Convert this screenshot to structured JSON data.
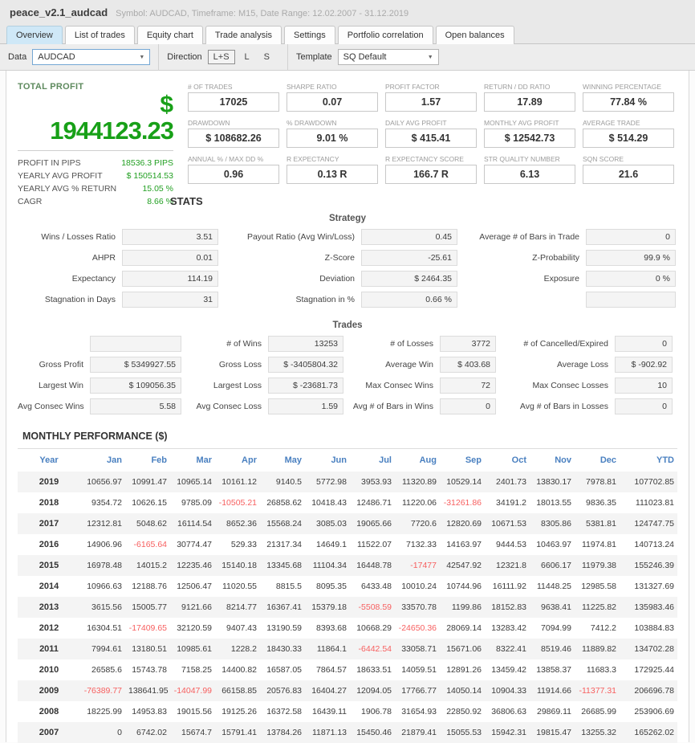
{
  "header": {
    "title": "peace_v2.1_audcad",
    "subtitle": "Symbol: AUDCAD, Timeframe: M15, Date Range: 12.02.2007 - 31.12.2019"
  },
  "tabs": [
    {
      "label": "Overview",
      "active": true
    },
    {
      "label": "List of trades",
      "active": false
    },
    {
      "label": "Equity chart",
      "active": false
    },
    {
      "label": "Trade analysis",
      "active": false
    },
    {
      "label": "Settings",
      "active": false
    },
    {
      "label": "Portfolio correlation",
      "active": false
    },
    {
      "label": "Open balances",
      "active": false
    }
  ],
  "toolbar": {
    "data_label": "Data",
    "data_value": "AUDCAD",
    "direction_label": "Direction",
    "direction_options": [
      "L+S",
      "L",
      "S"
    ],
    "direction_selected": "L+S",
    "template_label": "Template",
    "template_value": "SQ Default"
  },
  "total_profit": {
    "label": "TOTAL PROFIT",
    "currency": "$",
    "value": "1944123.23",
    "rows": [
      {
        "label": "PROFIT IN PIPS",
        "value": "18536.3 PIPS"
      },
      {
        "label": "YEARLY AVG PROFIT",
        "value": "$ 150514.53"
      },
      {
        "label": "YEARLY AVG % RETURN",
        "value": "15.05 %"
      },
      {
        "label": "CAGR",
        "value": "8.66 %"
      }
    ]
  },
  "stat_boxes": [
    {
      "label": "# OF TRADES",
      "value": "17025"
    },
    {
      "label": "SHARPE RATIO",
      "value": "0.07"
    },
    {
      "label": "PROFIT FACTOR",
      "value": "1.57"
    },
    {
      "label": "RETURN / DD RATIO",
      "value": "17.89"
    },
    {
      "label": "WINNING PERCENTAGE",
      "value": "77.84 %"
    },
    {
      "label": "DRAWDOWN",
      "value": "$ 108682.26"
    },
    {
      "label": "% DRAWDOWN",
      "value": "9.01 %"
    },
    {
      "label": "DAILY AVG PROFIT",
      "value": "$ 415.41"
    },
    {
      "label": "MONTHLY AVG PROFIT",
      "value": "$ 12542.73"
    },
    {
      "label": "AVERAGE TRADE",
      "value": "$ 514.29"
    },
    {
      "label": "ANNUAL % / MAX DD %",
      "value": "0.96"
    },
    {
      "label": "R EXPECTANCY",
      "value": "0.13 R"
    },
    {
      "label": "R EXPECTANCY SCORE",
      "value": "166.7 R"
    },
    {
      "label": "STR QUALITY NUMBER",
      "value": "6.13"
    },
    {
      "label": "SQN SCORE",
      "value": "21.6"
    }
  ],
  "stats_section": {
    "title": "STATS",
    "strategy": {
      "title": "Strategy",
      "rows": [
        [
          {
            "label": "Wins / Losses Ratio",
            "value": "3.51"
          },
          {
            "label": "Payout Ratio (Avg Win/Loss)",
            "value": "0.45"
          },
          {
            "label": "Average # of Bars in Trade",
            "value": "0"
          }
        ],
        [
          {
            "label": "AHPR",
            "value": "0.01"
          },
          {
            "label": "Z-Score",
            "value": "-25.61"
          },
          {
            "label": "Z-Probability",
            "value": "99.9 %"
          }
        ],
        [
          {
            "label": "Expectancy",
            "value": "114.19"
          },
          {
            "label": "Deviation",
            "value": "$ 2464.35"
          },
          {
            "label": "Exposure",
            "value": "0 %"
          }
        ],
        [
          {
            "label": "Stagnation in Days",
            "value": "31"
          },
          {
            "label": "Stagnation in %",
            "value": "0.66 %"
          },
          {
            "label": "",
            "value": ""
          }
        ]
      ]
    },
    "trades": {
      "title": "Trades",
      "rows": [
        [
          {
            "label": "",
            "value": ""
          },
          {
            "label": "# of Wins",
            "value": "13253"
          },
          {
            "label": "# of Losses",
            "value": "3772"
          },
          {
            "label": "# of Cancelled/Expired",
            "value": "0"
          }
        ],
        [
          {
            "label": "Gross Profit",
            "value": "$ 5349927.55"
          },
          {
            "label": "Gross Loss",
            "value": "$ -3405804.32"
          },
          {
            "label": "Average Win",
            "value": "$ 403.68"
          },
          {
            "label": "Average Loss",
            "value": "$ -902.92"
          }
        ],
        [
          {
            "label": "Largest Win",
            "value": "$ 109056.35"
          },
          {
            "label": "Largest Loss",
            "value": "$ -23681.73"
          },
          {
            "label": "Max Consec Wins",
            "value": "72"
          },
          {
            "label": "Max Consec Losses",
            "value": "10"
          }
        ],
        [
          {
            "label": "Avg Consec Wins",
            "value": "5.58"
          },
          {
            "label": "Avg Consec Loss",
            "value": "1.59"
          },
          {
            "label": "Avg # of Bars in Wins",
            "value": "0"
          },
          {
            "label": "Avg # of Bars in Losses",
            "value": "0"
          }
        ]
      ]
    }
  },
  "monthly": {
    "title": "MONTHLY PERFORMANCE ($)",
    "columns": [
      "Year",
      "Jan",
      "Feb",
      "Mar",
      "Apr",
      "May",
      "Jun",
      "Jul",
      "Aug",
      "Sep",
      "Oct",
      "Nov",
      "Dec",
      "YTD"
    ],
    "rows": [
      {
        "year": "2019",
        "values": [
          "10656.97",
          "10991.47",
          "10965.14",
          "10161.12",
          "9140.5",
          "5772.98",
          "3953.93",
          "11320.89",
          "10529.14",
          "2401.73",
          "13830.17",
          "7978.81",
          "107702.85"
        ]
      },
      {
        "year": "2018",
        "values": [
          "9354.72",
          "10626.15",
          "9785.09",
          "-10505.21",
          "26858.62",
          "10418.43",
          "12486.71",
          "11220.06",
          "-31261.86",
          "34191.2",
          "18013.55",
          "9836.35",
          "111023.81"
        ]
      },
      {
        "year": "2017",
        "values": [
          "12312.81",
          "5048.62",
          "16114.54",
          "8652.36",
          "15568.24",
          "3085.03",
          "19065.66",
          "7720.6",
          "12820.69",
          "10671.53",
          "8305.86",
          "5381.81",
          "124747.75"
        ]
      },
      {
        "year": "2016",
        "values": [
          "14906.96",
          "-6165.64",
          "30774.47",
          "529.33",
          "21317.34",
          "14649.1",
          "11522.07",
          "7132.33",
          "14163.97",
          "9444.53",
          "10463.97",
          "11974.81",
          "140713.24"
        ]
      },
      {
        "year": "2015",
        "values": [
          "16978.48",
          "14015.2",
          "12235.46",
          "15140.18",
          "13345.68",
          "11104.34",
          "16448.78",
          "-17477",
          "42547.92",
          "12321.8",
          "6606.17",
          "11979.38",
          "155246.39"
        ]
      },
      {
        "year": "2014",
        "values": [
          "10966.63",
          "12188.76",
          "12506.47",
          "11020.55",
          "8815.5",
          "8095.35",
          "6433.48",
          "10010.24",
          "10744.96",
          "16111.92",
          "11448.25",
          "12985.58",
          "131327.69"
        ]
      },
      {
        "year": "2013",
        "values": [
          "3615.56",
          "15005.77",
          "9121.66",
          "8214.77",
          "16367.41",
          "15379.18",
          "-5508.59",
          "33570.78",
          "1199.86",
          "18152.83",
          "9638.41",
          "11225.82",
          "135983.46"
        ]
      },
      {
        "year": "2012",
        "values": [
          "16304.51",
          "-17409.65",
          "32120.59",
          "9407.43",
          "13190.59",
          "8393.68",
          "10668.29",
          "-24650.36",
          "28069.14",
          "13283.42",
          "7094.99",
          "7412.2",
          "103884.83"
        ]
      },
      {
        "year": "2011",
        "values": [
          "7994.61",
          "13180.51",
          "10985.61",
          "1228.2",
          "18430.33",
          "11864.1",
          "-6442.54",
          "33058.71",
          "15671.06",
          "8322.41",
          "8519.46",
          "11889.82",
          "134702.28"
        ]
      },
      {
        "year": "2010",
        "values": [
          "26585.6",
          "15743.78",
          "7158.25",
          "14400.82",
          "16587.05",
          "7864.57",
          "18633.51",
          "14059.51",
          "12891.26",
          "13459.42",
          "13858.37",
          "11683.3",
          "172925.44"
        ]
      },
      {
        "year": "2009",
        "values": [
          "-76389.77",
          "138641.95",
          "-14047.99",
          "66158.85",
          "20576.83",
          "16404.27",
          "12094.05",
          "17766.77",
          "14050.14",
          "10904.33",
          "11914.66",
          "-11377.31",
          "206696.78"
        ]
      },
      {
        "year": "2008",
        "values": [
          "18225.99",
          "14953.83",
          "19015.56",
          "19125.26",
          "16372.58",
          "16439.11",
          "1906.78",
          "31654.93",
          "22850.92",
          "36806.63",
          "29869.11",
          "26685.99",
          "253906.69"
        ]
      },
      {
        "year": "2007",
        "values": [
          "0",
          "6742.02",
          "15674.7",
          "15791.41",
          "13784.26",
          "11871.13",
          "15450.46",
          "21879.41",
          "15055.53",
          "15942.31",
          "19815.47",
          "13255.32",
          "165262.02"
        ]
      }
    ]
  }
}
